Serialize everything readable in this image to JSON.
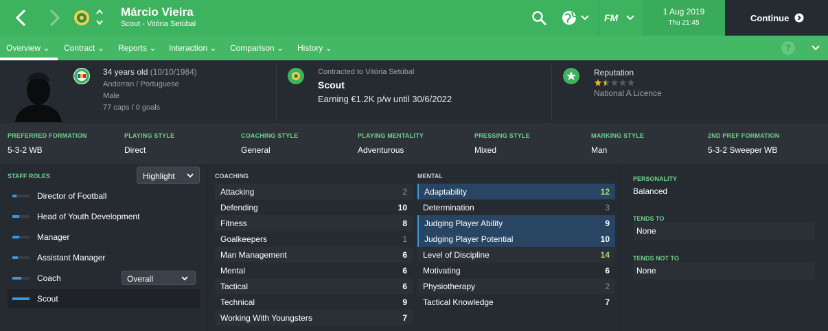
{
  "header": {
    "name": "Márcio Vieira",
    "subtitle": "Scout - Vitória Setúbal",
    "date": "1 Aug 2019",
    "time": "Thu 21:45",
    "fm_label": "FM",
    "continue_label": "Continue"
  },
  "tabs": [
    {
      "label": "Overview"
    },
    {
      "label": "Contract"
    },
    {
      "label": "Reports"
    },
    {
      "label": "Interaction"
    },
    {
      "label": "Comparison"
    },
    {
      "label": "History"
    }
  ],
  "help_label": "?",
  "profile": {
    "age": "34 years old",
    "dob": "(10/10/1984)",
    "nationality": "Andorran / Portuguese",
    "gender": "Male",
    "caps": "77 caps / 0 goals"
  },
  "contract": {
    "label": "Contracted to Vitória Setúbal",
    "role": "Scout",
    "earning": "Earning €1.2K p/w until 30/6/2022"
  },
  "reputation": {
    "label": "Reputation",
    "stars_filled": 1.5,
    "stars_total": 5,
    "licence": "National A Licence"
  },
  "preferences": [
    {
      "label": "PREFERRED FORMATION",
      "value": "5-3-2 WB"
    },
    {
      "label": "PLAYING STYLE",
      "value": "Direct"
    },
    {
      "label": "COACHING STYLE",
      "value": "General"
    },
    {
      "label": "PLAYING MENTALITY",
      "value": "Adventurous"
    },
    {
      "label": "PRESSING STYLE",
      "value": "Mixed"
    },
    {
      "label": "MARKING STYLE",
      "value": "Man"
    },
    {
      "label": "2ND PREF FORMATION",
      "value": "5-3-2 Sweeper WB"
    }
  ],
  "staff_roles": {
    "heading": "STAFF ROLES",
    "highlight_label": "Highlight",
    "overall_label": "Overall",
    "items": [
      {
        "label": "Director of Football",
        "suitability": 0.25
      },
      {
        "label": "Head of Youth Development",
        "suitability": 0.4
      },
      {
        "label": "Manager",
        "suitability": 0.4
      },
      {
        "label": "Assistant Manager",
        "suitability": 0.3
      },
      {
        "label": "Coach",
        "suitability": 0.5
      },
      {
        "label": "Scout",
        "suitability": 1.0
      }
    ]
  },
  "coaching": {
    "heading": "COACHING",
    "attributes": [
      {
        "name": "Attacking",
        "value": "2"
      },
      {
        "name": "Defending",
        "value": "10"
      },
      {
        "name": "Fitness",
        "value": "8"
      },
      {
        "name": "Goalkeepers",
        "value": "1"
      },
      {
        "name": "Man Management",
        "value": "6"
      },
      {
        "name": "Mental",
        "value": "6"
      },
      {
        "name": "Tactical",
        "value": "6"
      },
      {
        "name": "Technical",
        "value": "9"
      },
      {
        "name": "Working With Youngsters",
        "value": "7"
      }
    ]
  },
  "mental": {
    "heading": "MENTAL",
    "attributes": [
      {
        "name": "Adaptability",
        "value": "12"
      },
      {
        "name": "Determination",
        "value": "3"
      },
      {
        "name": "Judging Player Ability",
        "value": "9"
      },
      {
        "name": "Judging Player Potential",
        "value": "10"
      },
      {
        "name": "Level of Discipline",
        "value": "14"
      },
      {
        "name": "Motivating",
        "value": "6"
      },
      {
        "name": "Physiotherapy",
        "value": "2"
      },
      {
        "name": "Tactical Knowledge",
        "value": "7"
      }
    ]
  },
  "personality": {
    "label": "PERSONALITY",
    "value": "Balanced",
    "tends_to_label": "TENDS TO",
    "tends_to_value": "None",
    "tends_not_to_label": "TENDS NOT TO",
    "tends_not_to_value": "None"
  },
  "colors": {
    "accent": "#3db25f",
    "highlight_bar": "#3a97df",
    "star": "#e8b923"
  }
}
